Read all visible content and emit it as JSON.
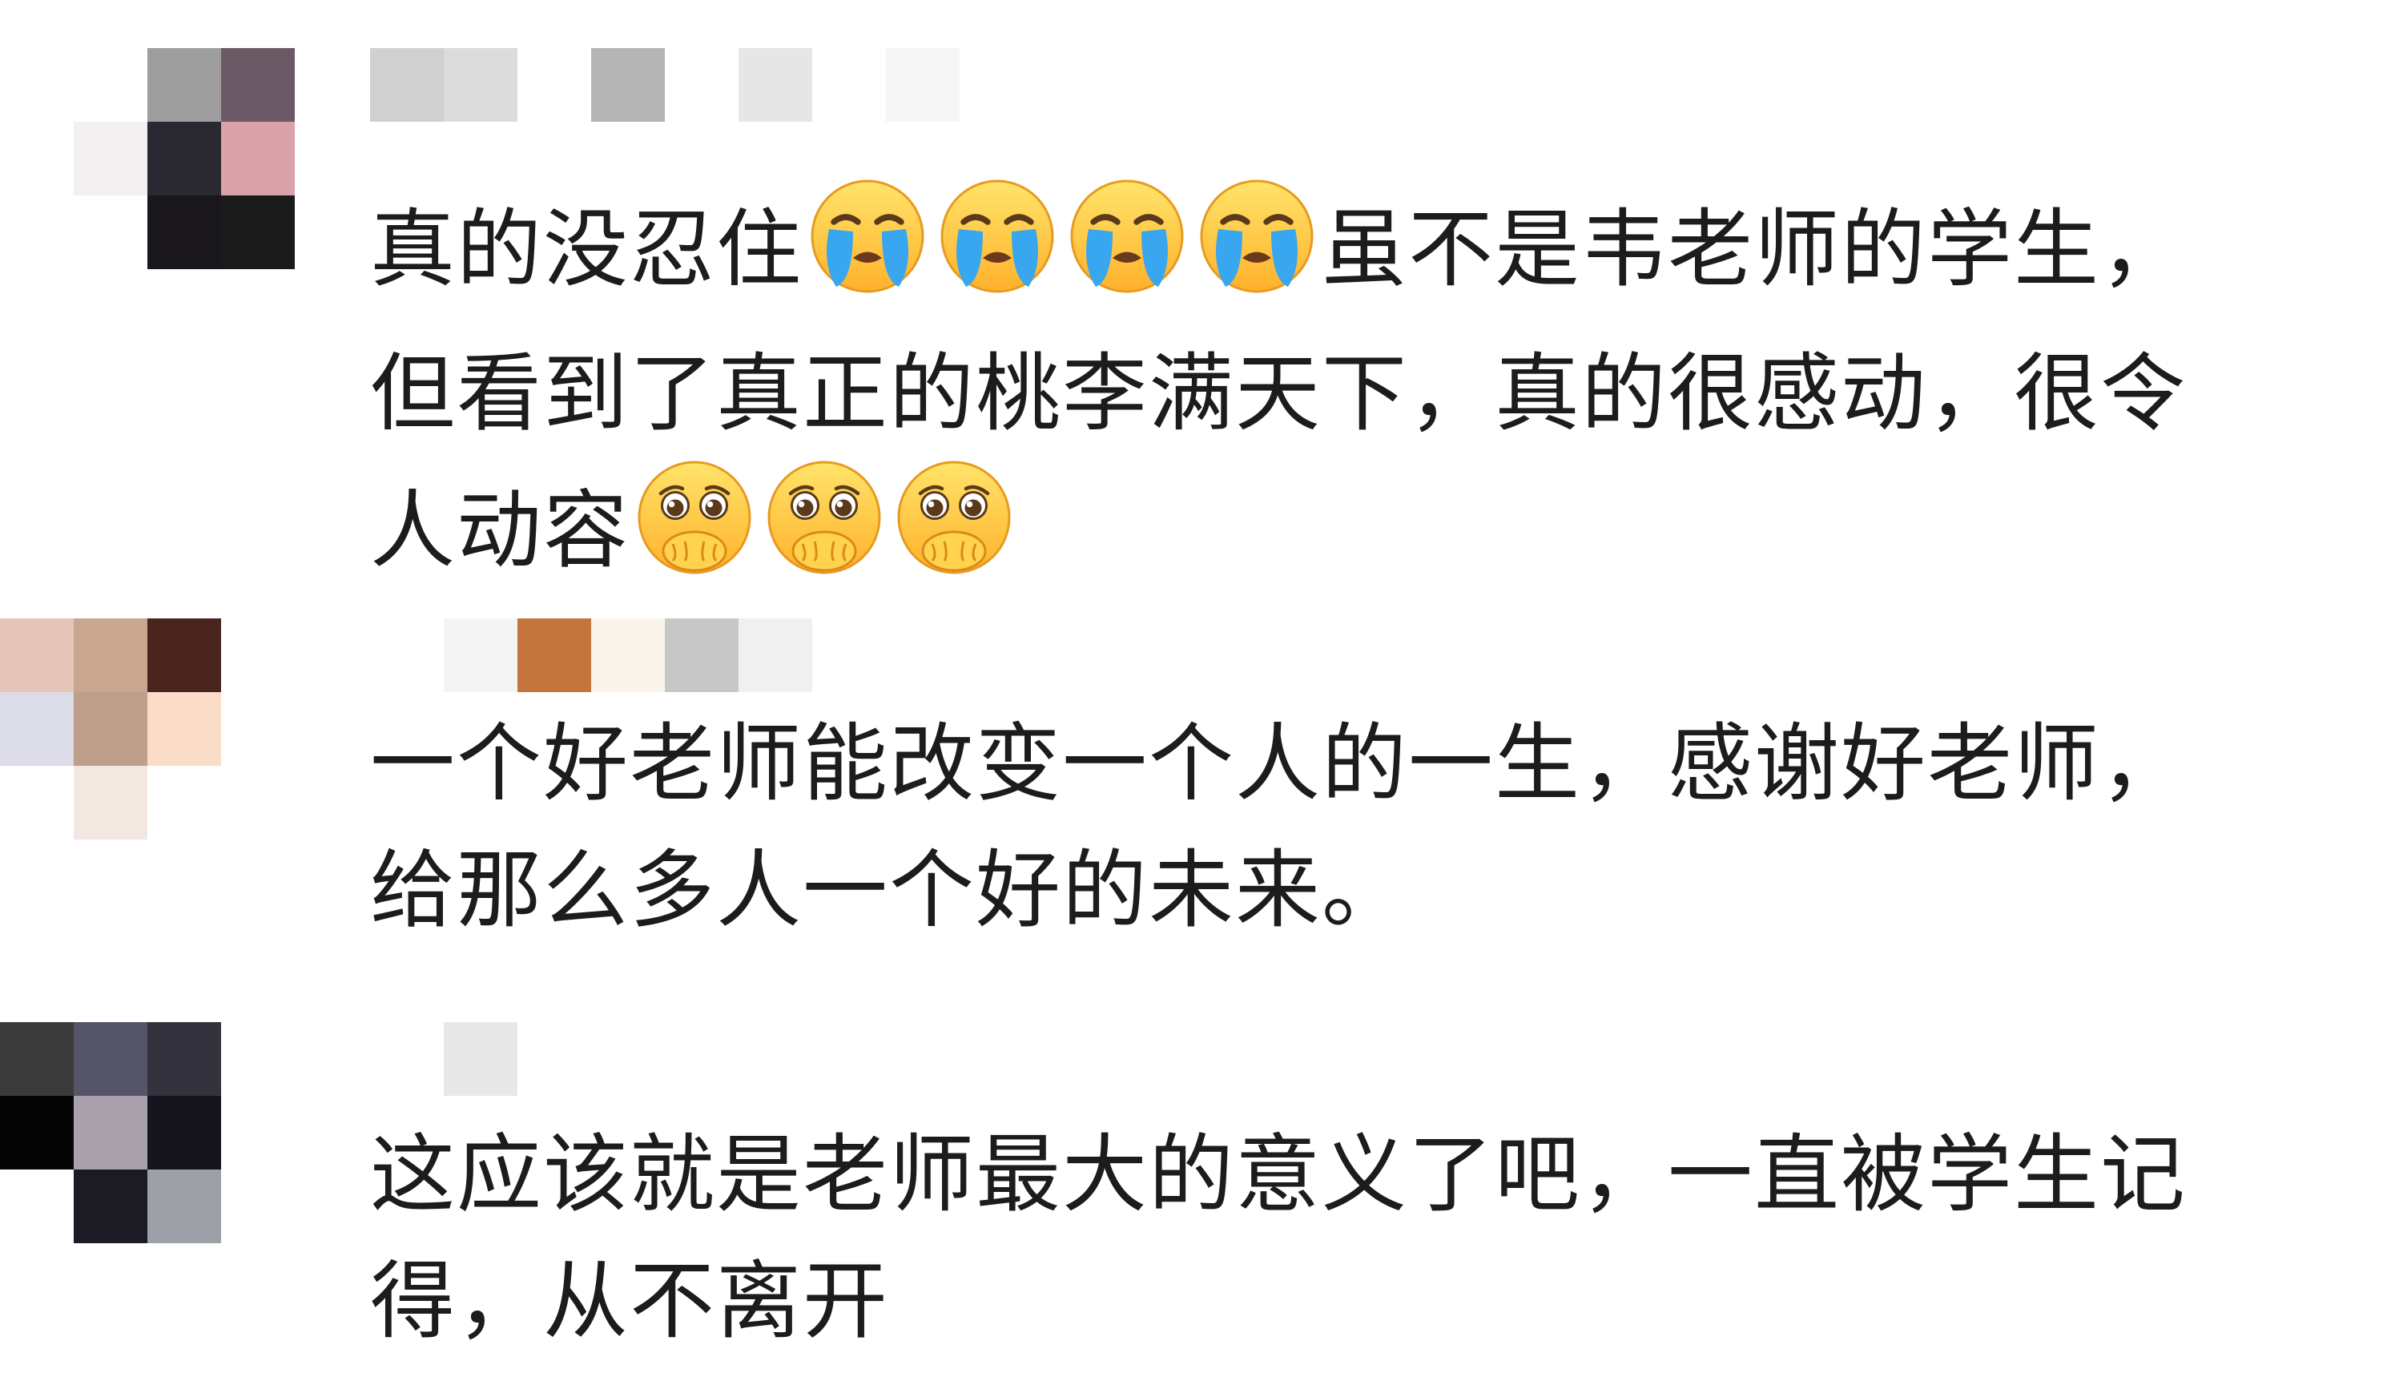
{
  "comments": [
    {
      "avatar": {
        "colors": [
          "#ffffff",
          "#9e9e9e",
          "#6b5a66",
          "#ffffff",
          "#f3f0f2",
          "#2a2830",
          "#d9a2aa",
          "#ffffff",
          "#ffffff",
          "#19171c",
          "#1a1a1a",
          "#ffffff",
          "#ffffff",
          "#ffffff",
          "#ffffff",
          "#ffffff"
        ]
      },
      "username_colors": [
        "#d0d0d0",
        "#dcdcdc",
        "#ffffff",
        "#b5b5b5",
        "#ffffff",
        "#e6e6e6",
        "#ffffff",
        "#f6f6f6"
      ],
      "text_part1": "真的没忍住",
      "emoji_group1": {
        "name": "loudly-crying-icon",
        "count": 4
      },
      "text_part2": "虽不是韦老师的学生，但看到了真正的桃李满天下，真的很感动，很令人动容",
      "emoji_group2": {
        "name": "holding-back-tears-icon",
        "count": 3
      }
    },
    {
      "avatar": {
        "colors": [
          "#e5c5b7",
          "#c9a690",
          "#4a2520",
          "#ffffff",
          "#dcdbe8",
          "#bd9f8a",
          "#fadcc9",
          "#ffffff",
          "#ffffff",
          "#f2e7e1",
          "#ffffff",
          "#ffffff",
          "#ffffff",
          "#ffffff",
          "#ffffff",
          "#ffffff"
        ]
      },
      "username_colors": [
        "#ffffff",
        "#f4f4f4",
        "#c4753b",
        "#fbf4ea",
        "#c7c7c7",
        "#f0f0f0"
      ],
      "text": "一个好老师能改变一个人的一生，感谢好老师，给那么多人一个好的未来。"
    },
    {
      "avatar": {
        "colors": [
          "#3b3b3b",
          "#555468",
          "#34333d",
          "#ffffff",
          "#050505",
          "#a8a1ab",
          "#16151d",
          "#ffffff",
          "#ffffff",
          "#1c1b24",
          "#9da0a6",
          "#ffffff",
          "#ffffff",
          "#ffffff",
          "#ffffff",
          "#ffffff"
        ]
      },
      "username_colors": [
        "#ffffff",
        "#e8e8e8"
      ],
      "text": "这应该就是老师最大的意义了吧，一直被学生记得，从不离开"
    }
  ]
}
